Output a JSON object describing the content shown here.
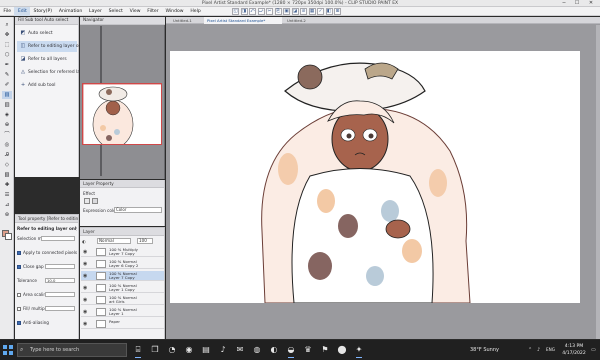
{
  "window": {
    "title": "Pixel Artist Standard Example* (1280 × 720px 350dpi 100.0%) - CLIP STUDIO PAINT EX",
    "min_symbol": "─",
    "max_symbol": "☐",
    "close_symbol": "✕"
  },
  "menu": [
    "File",
    "Edit",
    "Story(P)",
    "Animation",
    "Layer",
    "Select",
    "View",
    "Filter",
    "Window",
    "Help"
  ],
  "menu_active_index": 1,
  "command_icons": [
    "◱",
    "◨",
    "⤺",
    "⤻",
    "✂",
    "⎘",
    "▣",
    "◪",
    "⊘",
    "▦",
    "✓",
    "◧",
    "⊞"
  ],
  "tools": [
    "⌕",
    "✥",
    "⬚",
    "⬡",
    "✒",
    "✎",
    "✐",
    "▤",
    "▥",
    "◈",
    "⊕",
    "⌒",
    "◎",
    "Ꭿ",
    "◇",
    "▧",
    "✚",
    "☰",
    "⊿",
    "⊛"
  ],
  "active_tool_index": 7,
  "colors": {
    "main_color": "#dd9f8c",
    "sub_color": "#ffffff",
    "accent": "#3e6cb3"
  },
  "subtool": {
    "title": "Fill  Sub tool  Auto select",
    "items": [
      {
        "icon": "◩",
        "label": "Auto select"
      },
      {
        "icon": "◫",
        "label": "Refer to editing layer only"
      },
      {
        "icon": "◪",
        "label": "Refer to all layers"
      },
      {
        "icon": "◬",
        "label": "Selection for referred layers"
      },
      {
        "icon": "+",
        "label": "Add sub tool"
      }
    ],
    "selected_index": 1
  },
  "navigator": {
    "title": "Navigator"
  },
  "tool_property": {
    "title": "Tool property [Refer to editing layer only]",
    "subtitle": "Refer to editing layer only",
    "rows": [
      {
        "label": "Selection mode",
        "field": ""
      },
      {
        "label": "Apply to connected pixels only",
        "check": true
      },
      {
        "label": "Close gap",
        "check": true,
        "field": ""
      },
      {
        "label": "Tolerance",
        "field": "10.0"
      },
      {
        "label": "Area scaling",
        "check": false,
        "field": ""
      },
      {
        "label": "Fill/ multiple",
        "check": false,
        "field": ""
      },
      {
        "label": "Anti-aliasing",
        "check": true
      }
    ]
  },
  "layer_property": {
    "title": "Layer Property",
    "effect_label": "Effect",
    "expression_label": "Expression color",
    "expression_value": "Color"
  },
  "layer_panel": {
    "title": "Layer",
    "blend_mode": "Normal",
    "opacity": "100",
    "layers": [
      {
        "name": "100 % Multiply\nLayer 7 Copy",
        "selected": false
      },
      {
        "name": "100 % Normal\nLayer 6 Copy 2",
        "selected": false
      },
      {
        "name": "100 % Normal\nLayer 7 Copy",
        "selected": true
      },
      {
        "name": "100 % Normal\nLayer 1 Copy",
        "selected": false
      },
      {
        "name": "100 % Normal\nart Girls",
        "selected": false
      },
      {
        "name": "100 % Normal\nLayer 1",
        "selected": false
      },
      {
        "name": "Paper",
        "selected": false
      }
    ]
  },
  "canvas_tabs": [
    {
      "label": "Untitled-1",
      "active": false
    },
    {
      "label": "Pixel Artist Standard Example*",
      "active": true
    },
    {
      "label": "Untitled-2",
      "active": false
    }
  ],
  "taskbar": {
    "search_placeholder": "Type here to search",
    "apps": [
      "⌸",
      "❒",
      "◔",
      "◉",
      "▤",
      "♪",
      "✉",
      "◍",
      "◐",
      "◒",
      "♛",
      "⚑",
      "⬤",
      "✦"
    ],
    "weather": "38°F  Sunny",
    "lang": "ENG",
    "time": "4:13 PM",
    "date": "4/17/2022"
  }
}
